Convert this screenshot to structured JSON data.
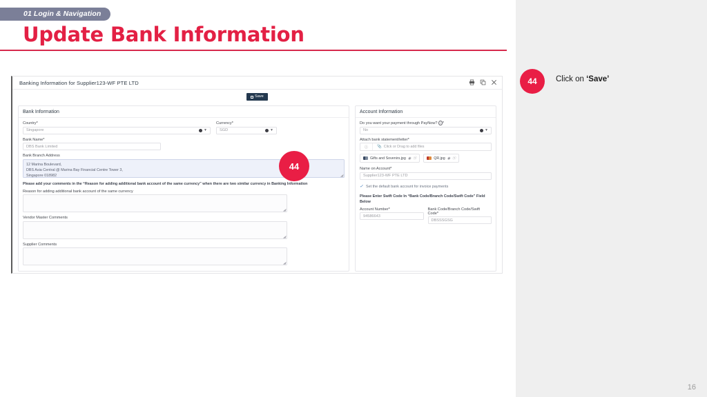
{
  "slide": {
    "section_tag": "01 Login & Navigation",
    "title": "Update Bank Information",
    "page_number": "16",
    "accent_color": "#e32044",
    "tag_color": "#7b7f98"
  },
  "callout": {
    "badge": "44",
    "text_prefix": "Click on ",
    "text_strong": "‘Save’"
  },
  "screenshot": {
    "window_title": "Banking Information for Supplier123-WF PTE LTD",
    "window_icons": [
      "print-icon",
      "copy-icon",
      "close-icon"
    ],
    "step_badge": "44",
    "toolbar": {
      "save_label": "Save"
    },
    "bank_panel": {
      "heading": "Bank Information",
      "country_label": "Country",
      "country_required": "*",
      "country_value": "Singapore",
      "currency_label": "Currency",
      "currency_required": "*",
      "currency_value": "SGD",
      "bank_name_label": "Bank Name",
      "bank_name_required": "*",
      "bank_name_value": "DBS Bank Limited",
      "branch_address_label": "Bank Branch Address",
      "branch_address_line1": "12 Marina Boulevard,",
      "branch_address_line2": "DBS Asia Central @ Marina Bay Financial Centre Tower 3,",
      "branch_address_line3": "Singapore 018982",
      "instruction": "Please add your comments in the “Reason for adding additional bank account of the same currency” when there are two similar currency in Banking Information",
      "reason_label": "Reason for adding additional bank account of the same currency",
      "reason_value": "",
      "vendor_comments_label": "Vendor Master Comments",
      "vendor_comments_value": "",
      "supplier_comments_label": "Supplier Comments",
      "supplier_comments_value": ""
    },
    "account_panel": {
      "heading": "Account Information",
      "paynow_label": "Do you want your payment through PayNow?",
      "paynow_info_icon": "info-icon",
      "paynow_required": "*",
      "paynow_value": "No",
      "attach_label": "Attach bank statement/letter",
      "attach_required": "*",
      "attach_info_icon": "info-icon",
      "attach_drop_text": "Click or Drag to add files",
      "attachments": [
        {
          "name": "Gifts and Sovenirs.jpg",
          "thumb": "image-thumb-icon"
        },
        {
          "name": "QR.jpg",
          "thumb": "image-thumb-icon"
        }
      ],
      "name_on_account_label": "Name on Account",
      "name_on_account_required": "*",
      "name_on_account_value": "Supplier123-WF PTE LTD",
      "default_account_checkbox_label": "Set the default bank account for invoice payments",
      "default_account_checked": true,
      "swift_note": "Please Enter Swift Code In “Bank Code/Branch Code/Swift Code” Field Below",
      "account_number_label": "Account Number",
      "account_number_required": "*",
      "account_number_value": "94586643",
      "bank_code_label": "Bank Code/Branch Code/Swift Code",
      "bank_code_required": "*",
      "bank_code_value": "DBSSSGSG"
    }
  }
}
